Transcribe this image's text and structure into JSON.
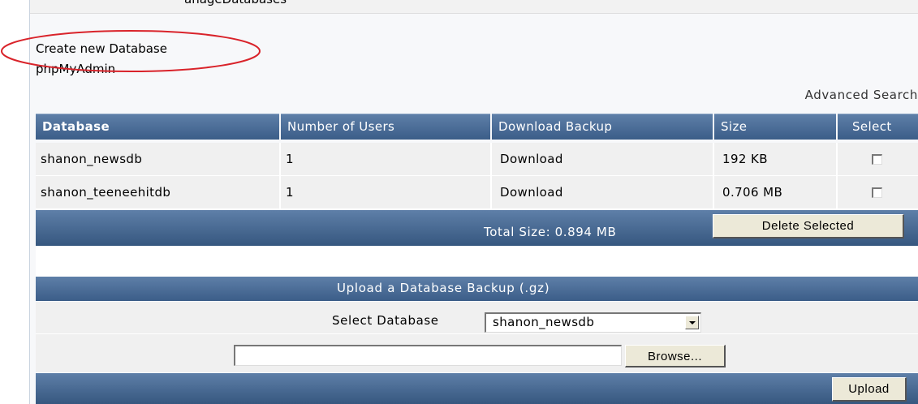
{
  "top": {
    "cut_text": "anageDatabases"
  },
  "links": {
    "create_db": "Create new Database",
    "phpmyadmin": "phpMyAdmin",
    "advanced_search": "Advanced Search"
  },
  "table": {
    "headers": {
      "database": "Database",
      "users": "Number of Users",
      "download": "Download Backup",
      "size": "Size",
      "select": "Select"
    },
    "rows": [
      {
        "name": "shanon_newsdb",
        "users": "1",
        "download": "Download",
        "size": "192 KB",
        "selected": false
      },
      {
        "name": "shanon_teeneehitdb",
        "users": "1",
        "download": "Download",
        "size": "0.706 MB",
        "selected": false
      }
    ],
    "total_size": "Total Size: 0.894 MB",
    "delete_label": "Delete Selected"
  },
  "upload": {
    "title": "Upload a Database Backup (.gz)",
    "select_label": "Select Database",
    "selected_db": "shanon_newsdb",
    "file_value": "",
    "browse_label": "Browse...",
    "upload_label": "Upload"
  },
  "annotation": {
    "color": "#d9232a"
  }
}
